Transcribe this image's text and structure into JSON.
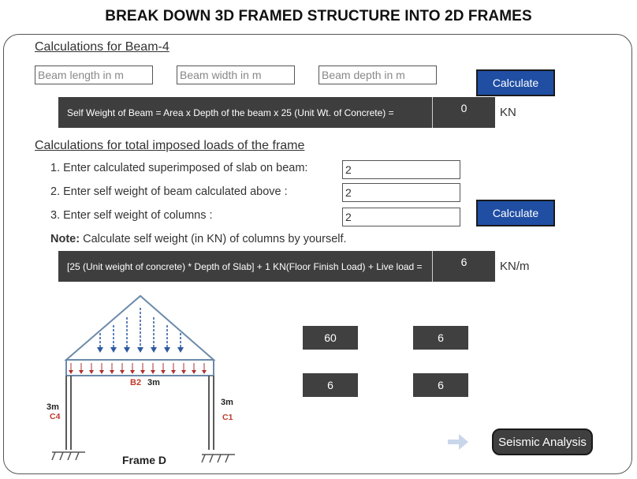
{
  "page": {
    "title": "BREAK DOWN 3D FRAMED STRUCTURE INTO 2D FRAMES"
  },
  "beam_section": {
    "heading": "Calculations for Beam-4",
    "length_placeholder": "Beam length in m",
    "width_placeholder": "Beam width in m",
    "depth_placeholder": "Beam depth in m",
    "calculate_label": "Calculate",
    "formula": "Self Weight of Beam = Area x Depth of the beam x 25 (Unit Wt. of Concrete) =",
    "result": "0",
    "unit": "KN"
  },
  "load_section": {
    "heading": "Calculations for total imposed loads of the frame",
    "items": [
      {
        "label": "1. Enter calculated superimposed of slab on beam:",
        "value": "2"
      },
      {
        "label": "2. Enter self weight of beam calculated above :",
        "value": "2"
      },
      {
        "label": "3. Enter self weight of columns :",
        "value": "2"
      }
    ],
    "calculate_label": "Calculate",
    "note_label": "Note:",
    "note_text": " Calculate self weight (in KN) of columns by yourself.",
    "formula": "[25 (Unit weight of concrete) * Depth of Slab] + 1 KN(Floor Finish Load) + Live load =",
    "result": "6",
    "unit": "KN/m"
  },
  "results": [
    "60",
    "6",
    "6",
    "6"
  ],
  "diagram": {
    "beam_label": "B2",
    "beam_span": "3m",
    "left_height": "3m",
    "left_column": "C4",
    "right_height": "3m",
    "right_column": "C1",
    "frame_name": "Frame D"
  },
  "navigation": {
    "seismic_label": "Seismic Analysis"
  },
  "colors": {
    "button_blue": "#1f4ea3",
    "dark_bar": "#3e3e3e",
    "column_label_red": "#c0392b",
    "slab_arrow_blue": "#2c5aa0",
    "beam_arrow_red": "#b03030"
  }
}
